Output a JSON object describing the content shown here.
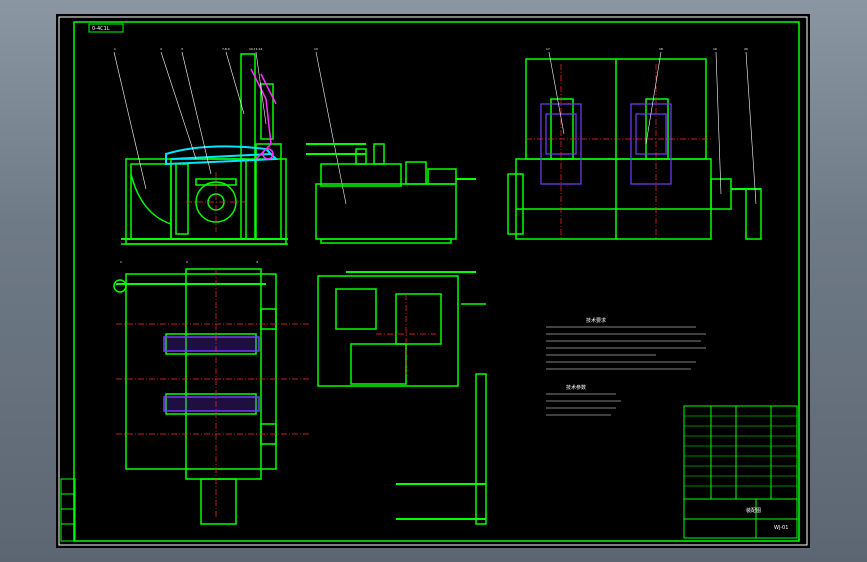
{
  "sheet": {
    "frame_code": "0-4C1L",
    "background": "#000000",
    "line_color": "#00ff00",
    "accent_colors": {
      "cyan": "#00e5ff",
      "magenta": "#ff30ff",
      "purple": "#7a3cff",
      "red": "#ff2a2a",
      "white": "#ffffff",
      "yellow": "#e5e500"
    }
  },
  "callouts_front": [
    "1",
    "4",
    "3",
    "7,8,9",
    "10,11,12",
    "13"
  ],
  "callouts_side": [
    "17",
    "18",
    "19",
    "20"
  ],
  "callouts_plan": [
    "1",
    "2",
    "3"
  ],
  "notes": {
    "heading_1": "技术要求",
    "heading_2": "技术参数"
  },
  "title_block": {
    "name_cell": "装配图",
    "drawing_no": "WJ-01"
  }
}
